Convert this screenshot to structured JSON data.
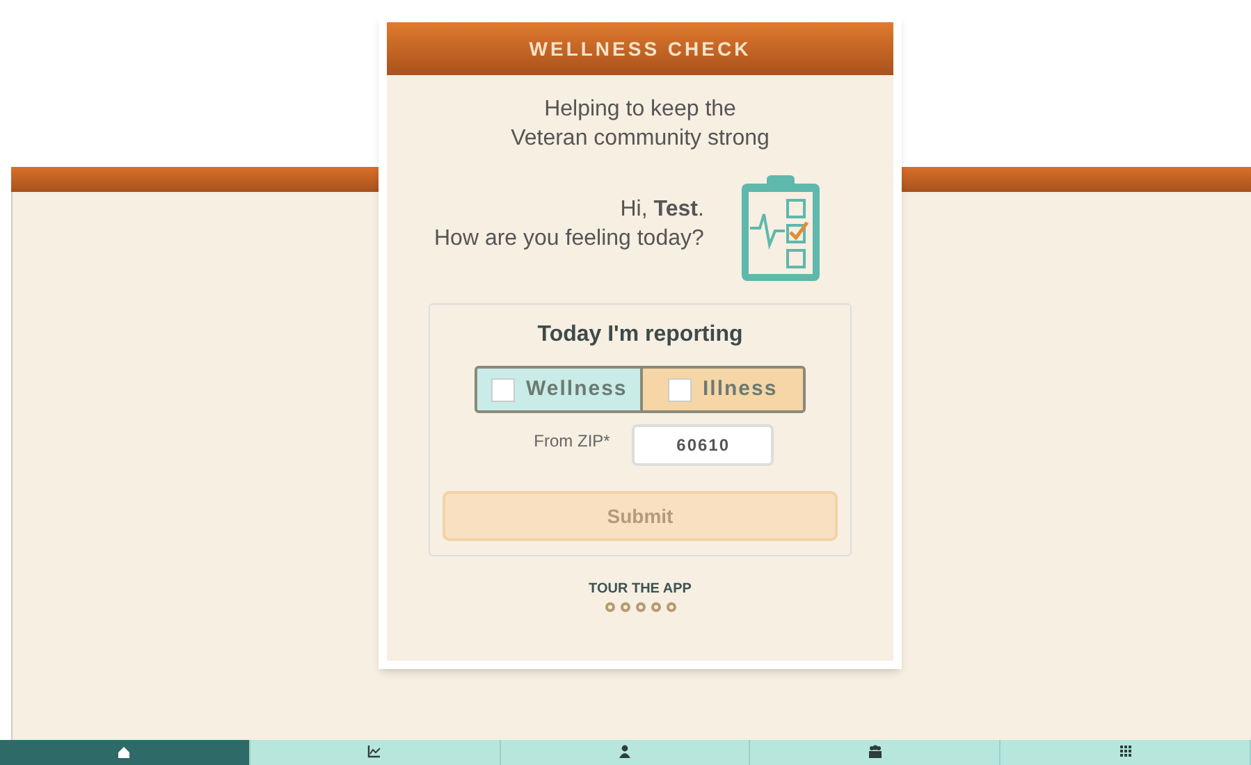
{
  "dialog": {
    "title": "WELLNESS CHECK",
    "tagline": [
      "Helping to keep the",
      "Veteran community strong"
    ],
    "greeting": "Hi, **Test**.",
    "question": "How are you feeling today?",
    "report": {
      "heading": "Today I'm reporting",
      "options": [
        {
          "label": "Wellness",
          "checked": false,
          "color": "#c9ece8"
        },
        {
          "label": "Illness",
          "checked": false,
          "color": "#f6d6a6"
        }
      ],
      "zip_label": "From ZIP*",
      "zip_value": "60610",
      "submit": {
        "label": "Submit",
        "disabled": true
      }
    },
    "tour": {
      "label": "TOUR THE APP",
      "dots": [
        {
          "selected": false
        },
        {
          "selected": false
        },
        {
          "selected": false
        },
        {
          "selected": false
        },
        {
          "selected": false
        }
      ]
    }
  },
  "nav": [
    {
      "selected": true
    },
    {
      "selected": false
    },
    {
      "selected": false
    },
    {
      "selected": false
    },
    {
      "selected": false
    }
  ]
}
